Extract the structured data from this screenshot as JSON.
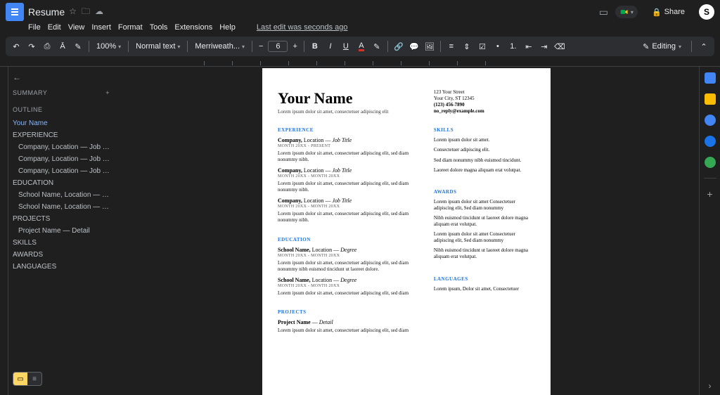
{
  "title": "Resume",
  "menu": [
    "File",
    "Edit",
    "View",
    "Insert",
    "Format",
    "Tools",
    "Extensions",
    "Help"
  ],
  "last_edit": "Last edit was seconds ago",
  "share_label": "Share",
  "avatar_initial": "S",
  "toolbar": {
    "zoom": "100%",
    "style": "Normal text",
    "font": "Merriweath...",
    "font_size": "6",
    "editing": "Editing"
  },
  "outline": {
    "summary": "SUMMARY",
    "outline_label": "OUTLINE",
    "items": [
      {
        "lvl": 1,
        "label": "Your Name",
        "selected": true
      },
      {
        "lvl": 2,
        "label": "EXPERIENCE"
      },
      {
        "lvl": 3,
        "label": "Company, Location — Job Title"
      },
      {
        "lvl": 3,
        "label": "Company, Location — Job Title"
      },
      {
        "lvl": 3,
        "label": "Company, Location — Job Title"
      },
      {
        "lvl": 2,
        "label": "EDUCATION"
      },
      {
        "lvl": 3,
        "label": "School Name, Location — Degr..."
      },
      {
        "lvl": 3,
        "label": "School Name, Location — Degr..."
      },
      {
        "lvl": 2,
        "label": "PROJECTS"
      },
      {
        "lvl": 3,
        "label": "Project Name — Detail"
      },
      {
        "lvl": 2,
        "label": "SKILLS"
      },
      {
        "lvl": 2,
        "label": "AWARDS"
      },
      {
        "lvl": 2,
        "label": "LANGUAGES"
      }
    ]
  },
  "resume": {
    "name": "Your Name",
    "tagline": "Lorem ipsum dolor sit amet, consectetuer adipiscing elit",
    "contact": {
      "street": "123 Your Street",
      "city": "Your City, ST 12345",
      "phone": "(123) 456-7890",
      "email": "no_reply@example.com"
    },
    "sections": {
      "experience": "EXPERIENCE",
      "education": "EDUCATION",
      "projects": "PROJECTS",
      "skills": "SKILLS",
      "awards": "AWARDS",
      "languages": "LANGUAGES"
    },
    "jobs": [
      {
        "co": "Company,",
        "loc": "Location",
        "title": "Job Title",
        "dates": "MONTH 20XX - PRESENT",
        "desc": "Lorem ipsum dolor sit amet, consectetuer adipiscing elit, sed diam nonummy nibh."
      },
      {
        "co": "Company,",
        "loc": "Location",
        "title": "Job Title",
        "dates": "MONTH 20XX - MONTH 20XX",
        "desc": "Lorem ipsum dolor sit amet, consectetuer adipiscing elit, sed diam nonummy nibh."
      },
      {
        "co": "Company,",
        "loc": "Location",
        "title": "Job Title",
        "dates": "MONTH 20XX - MONTH 20XX",
        "desc": "Lorem ipsum dolor sit amet, consectetuer adipiscing elit, sed diam nonummy nibh."
      }
    ],
    "schools": [
      {
        "name": "School Name,",
        "loc": "Location",
        "deg": "Degree",
        "dates": "MONTH 20XX - MONTH 20XX",
        "desc": "Lorem ipsum dolor sit amet, consectetuer adipiscing elit, sed diam nonummy nibh euismod tincidunt ut laoreet dolore."
      },
      {
        "name": "School Name,",
        "loc": "Location",
        "deg": "Degree",
        "dates": "MONTH 20XX - MONTH 20XX",
        "desc": "Lorem ipsum dolor sit amet, consectetuer adipiscing elit, sed diam"
      }
    ],
    "project": {
      "name": "Project Name",
      "detail": "Detail",
      "desc": "Lorem ipsum dolor sit amet, consectetuer adipiscing elit, sed diam"
    },
    "skills_text": [
      "Lorem ipsum dolor sit amet.",
      "Consectetuer adipiscing elit.",
      "Sed diam nonummy nibh euismod tincidunt.",
      "Laoreet dolore magna aliquam erat volutpat."
    ],
    "awards_text": [
      "Lorem ipsum dolor sit amet Consectetuer adipiscing elit, Sed diam nonummy",
      "Nibh euismod tincidunt ut laoreet dolore magna aliquam erat volutpat.",
      "Lorem ipsum dolor sit amet Consectetuer adipiscing elit, Sed diam nonummy",
      "Nibh euismod tincidunt ut laoreet dolore magna aliquam erat volutpat."
    ],
    "languages_text": "Lorem ipsum, Dolor sit amet, Consectetuer"
  }
}
